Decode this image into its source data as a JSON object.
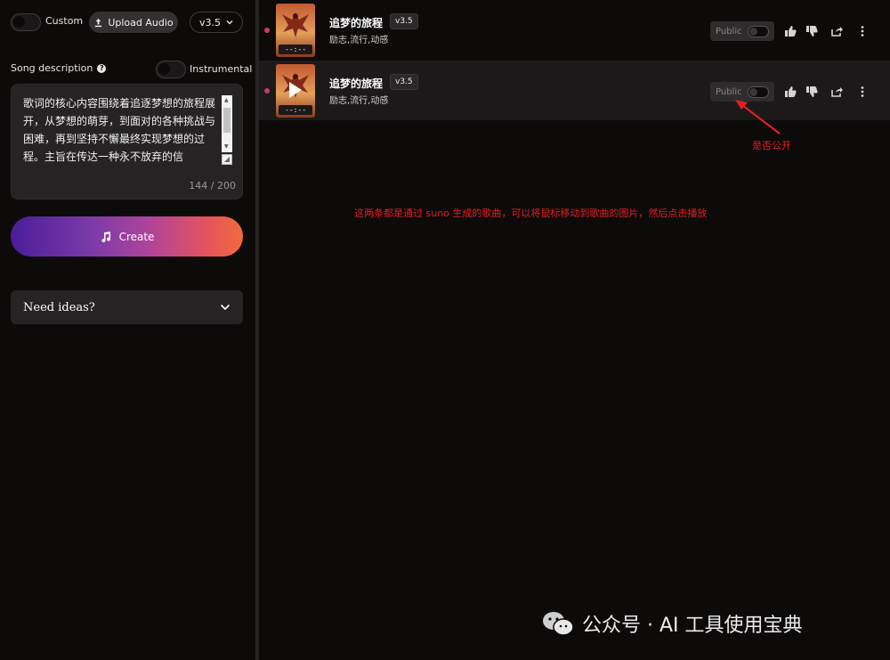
{
  "left": {
    "custom_label": "Custom",
    "upload_label": "Upload Audio",
    "version": "v3.5",
    "song_description_label": "Song description",
    "help_symbol": "?",
    "instrumental_label": "Instrumental",
    "description_text": "歌词的核心内容围绕着追逐梦想的旅程展开，从梦想的萌芽，到面对的各种挑战与困难，再到坚持不懈最终实现梦想的过程。主旨在传达一种永不放弃的信",
    "char_count": "144 / 200",
    "create_label": "Create",
    "ideas_label": "Need ideas?"
  },
  "songs": [
    {
      "title": "追梦的旅程",
      "version": "v3.5",
      "tags": "励志,流行,动感",
      "duration": "--:--",
      "public_label": "Public"
    },
    {
      "title": "追梦的旅程",
      "version": "v3.5",
      "tags": "励志,流行,动感",
      "duration": "--:--",
      "public_label": "Public"
    }
  ],
  "annotations": {
    "public_note": "是否公开",
    "hint": "这两条都是通过 suno 生成的歌曲，可以将鼠标移动到歌曲的图片，然后点击播放"
  },
  "watermark": {
    "text": "公众号 · AI 工具使用宝典"
  },
  "colors": {
    "background": "#0d0a0a",
    "panel": "#262324",
    "accent_dot": "#c93a66",
    "annotation": "#e02020"
  }
}
